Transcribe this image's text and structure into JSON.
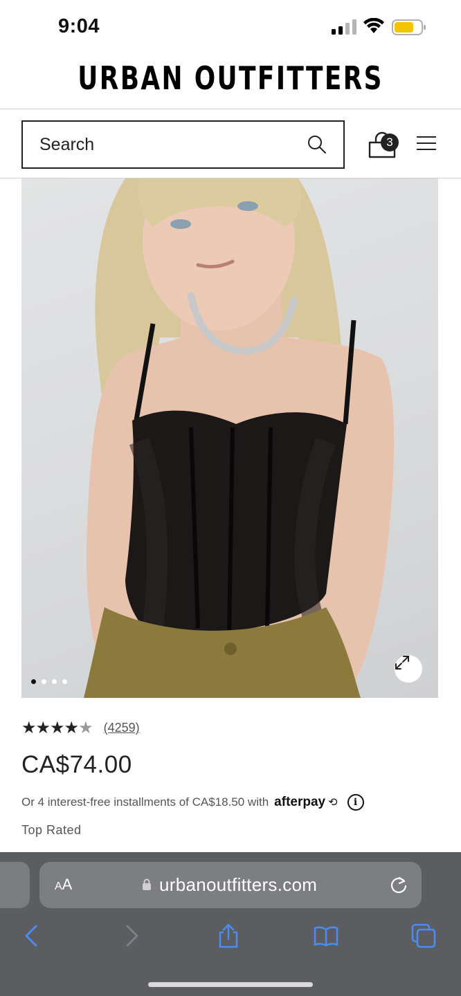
{
  "status_bar": {
    "time": "9:04",
    "signal_icon": "cellular-signal-icon",
    "wifi_icon": "wifi-icon",
    "battery_icon": "battery-low-power-icon",
    "battery_color": "#f5c400"
  },
  "header": {
    "brand": "URBAN OUTFITTERS"
  },
  "search": {
    "placeholder": "Search",
    "icon": "search-icon"
  },
  "cart": {
    "icon": "shopping-bag-icon",
    "count": "3"
  },
  "menu": {
    "icon": "hamburger-menu-icon"
  },
  "product": {
    "image_dots": 4,
    "active_dot": 0,
    "expand_icon": "expand-icon",
    "rating": 4.5,
    "stars": "★★★★",
    "half_star": "★",
    "review_count": "(4259)",
    "price": "CA$74.00",
    "installments_text": "Or 4 interest-free installments of CA$18.50 with",
    "afterpay_label": "afterpay",
    "afterpay_symbol": "⟲",
    "info_label": "i",
    "badge": "Top Rated"
  },
  "browser": {
    "text_size_label_small": "A",
    "text_size_label_large": "A",
    "url": "urbanoutfitters.com",
    "lock_icon": "lock-icon",
    "reload_icon": "reload-icon",
    "toolbar": [
      "back-icon",
      "forward-icon",
      "share-icon",
      "bookmarks-icon",
      "tabs-icon"
    ],
    "accent_color": "#4a8cf2"
  }
}
